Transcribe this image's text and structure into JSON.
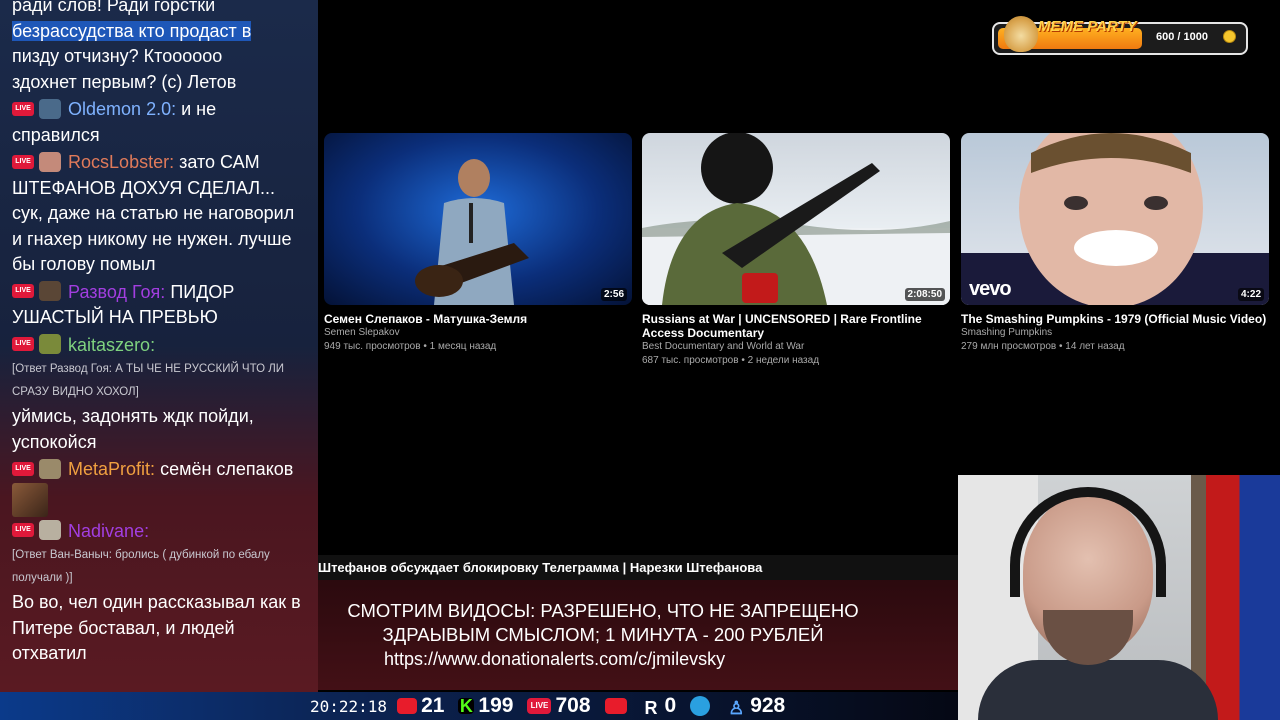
{
  "chat": {
    "top_lines": [
      "ради слов! Ради горстки",
      "безрассудства кто продаст в",
      "пизду отчизну? Ктоооооо",
      "здохнет первым? (с) Летов"
    ],
    "messages": [
      {
        "user": "Oldemon 2.0:",
        "user_color": "#7fb2ff",
        "text": "и не справился",
        "badge": "LIVE"
      },
      {
        "user": "RocsLobster:",
        "user_color": "#e07a5a",
        "text": "зато САМ ШТЕФАНОВ ДОХУЯ СДЕЛАЛ... сук, даже на статью не наговорил и гнахер никому не нужен. лучше бы голову помыл",
        "badge": "LIVE"
      },
      {
        "user": "Развод Гоя:",
        "user_color": "#a23ee0",
        "text": "ПИДОР УШАСТЫЙ НА ПРЕВЬЮ",
        "badge": "LIVE"
      },
      {
        "user": "kaitaszero:",
        "user_color": "#7fd27f",
        "reply": "[Ответ Развод Гоя: А ТЫ ЧЕ НЕ РУССКИЙ ЧТО ЛИ СРАЗУ ВИДНО ХОХОЛ]",
        "text": "уймись, задонять ждк пойди, успокойся",
        "badge": "LIVE"
      },
      {
        "user": "MetaProfit:",
        "user_color": "#f0a040",
        "text": "семён слепаков",
        "badge": "LIVE"
      },
      {
        "user": "Nadivane:",
        "user_color": "#a23ee0",
        "reply": "[Ответ Ван-Ваныч: бролись ( дубинкой по ебалу получали )]",
        "text": "Во во, чел один рассказывал как в Питере боставал, и людей отхватил",
        "badge": "LIVE"
      }
    ]
  },
  "widget": {
    "title": "MEME PARTY",
    "counter": "600 / 1000",
    "progress": 0.6
  },
  "videos": [
    {
      "title": "Семен Слепаков - Матушка-Земля",
      "channel": "Semen Slepakov",
      "meta": "949 тыс. просмотров • 1 месяц назад",
      "duration": "2:56"
    },
    {
      "title": "Russians at War | UNCENSORED | Rare Frontline Access Documentary",
      "channel": "Best Documentary and World at War",
      "meta": "687 тыс. просмотров • 2 недели назад",
      "duration": "2:08:50"
    },
    {
      "title": "The Smashing Pumpkins - 1979 (Official Music Video)",
      "channel": "Smashing Pumpkins",
      "meta": "279 млн просмотров • 14 лет назад",
      "duration": "4:22",
      "logo": "vevo"
    }
  ],
  "ticker": "Штефанов обсуждает блокировку Телеграмма | Нарезки Штефанова",
  "rules": {
    "line1": "СМОТРИМ ВИДОСЫ: РАЗРЕШЕНО, ЧТО НЕ ЗАПРЕЩЕНО",
    "line2": "ЗДРАЫВЫМ СМЫСЛОМ; 1 МИНУТА - 200 РУБЛЕЙ",
    "link": "https://www.donationalerts.com/c/jmilevsky"
  },
  "status": {
    "time": "20:22:18",
    "youtube": "21",
    "kick": "199",
    "vk_live": "708",
    "rutube": "",
    "rumble": "0",
    "telegram": "",
    "viewers": "928"
  },
  "colors": {
    "accent_blue": "#1e57b8",
    "live_red": "#e0193a"
  },
  "icons": {
    "youtube": "youtube-icon",
    "kick": "kick-icon",
    "vk": "vk-live-icon",
    "rutube": "rutube-icon",
    "rumble": "rumble-icon",
    "telegram": "telegram-icon",
    "viewers": "viewers-icon"
  }
}
